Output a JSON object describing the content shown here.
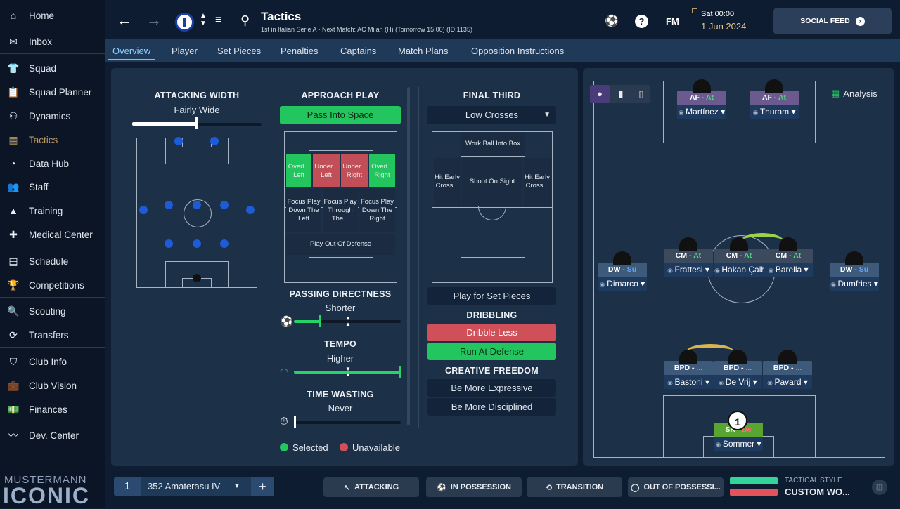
{
  "sidebar": {
    "items": [
      {
        "label": "Home",
        "icon": "home-icon"
      },
      {
        "label": "Inbox",
        "icon": "inbox-icon"
      },
      {
        "label": "Squad",
        "icon": "shirt-icon"
      },
      {
        "label": "Squad Planner",
        "icon": "clipboard-icon"
      },
      {
        "label": "Dynamics",
        "icon": "dynamics-icon"
      },
      {
        "label": "Tactics",
        "icon": "tactics-board-icon"
      },
      {
        "label": "Data Hub",
        "icon": "data-hub-icon"
      },
      {
        "label": "Staff",
        "icon": "staff-icon"
      },
      {
        "label": "Training",
        "icon": "training-cone-icon"
      },
      {
        "label": "Medical Center",
        "icon": "medical-kit-icon"
      },
      {
        "label": "Schedule",
        "icon": "calendar-icon"
      },
      {
        "label": "Competitions",
        "icon": "trophy-icon"
      },
      {
        "label": "Scouting",
        "icon": "magnifier-icon"
      },
      {
        "label": "Transfers",
        "icon": "transfer-arrows-icon"
      },
      {
        "label": "Club Info",
        "icon": "shield-icon"
      },
      {
        "label": "Club Vision",
        "icon": "briefcase-icon"
      },
      {
        "label": "Finances",
        "icon": "money-icon"
      },
      {
        "label": "Dev. Center",
        "icon": "dev-center-icon"
      }
    ],
    "brand_top": "MUSTERMANN",
    "brand_bottom": "ICONIC"
  },
  "topbar": {
    "title": "Tactics",
    "subtitle": "1st in Italian Serie A - Next Match: AC Milan (H) (Tomorrow 15:00) (ID:1135)",
    "date_line1": "Sat 00:00",
    "date_line2": "1 Jun 2024",
    "fm_label": "FM",
    "social_feed": "SOCIAL FEED"
  },
  "tabs": [
    "Overview",
    "Player",
    "Set Pieces",
    "Penalties",
    "Captains",
    "Match Plans",
    "Opposition Instructions"
  ],
  "attacking_width": {
    "title": "ATTACKING WIDTH",
    "value": "Fairly Wide",
    "level": 0.5
  },
  "approach_play": {
    "title": "APPROACH PLAY",
    "selected": "Pass Into Space",
    "zones": {
      "overlap_left": "Overl... Left",
      "underlap_left": "Under... Left",
      "underlap_right": "Under... Right",
      "overlap_right": "Overl... Right",
      "focus_left": "Focus Play Down The Left",
      "focus_centre": "Focus Play Through The...",
      "focus_right": "Focus Play Down The Right",
      "play_out": "Play Out Of Defense"
    }
  },
  "passing_directness": {
    "title": "PASSING DIRECTNESS",
    "value": "Shorter",
    "level": 0.25
  },
  "tempo": {
    "title": "TEMPO",
    "value": "Higher",
    "level": 1.0
  },
  "time_wasting": {
    "title": "TIME WASTING",
    "value": "Never",
    "level": 0.0
  },
  "final_third": {
    "title": "FINAL THIRD",
    "dropdown": "Low Crosses",
    "zones": {
      "work_ball": "Work Ball Into Box",
      "hit_left": "Hit Early Cross...",
      "shoot": "Shoot On Sight",
      "hit_right": "Hit Early Cross..."
    },
    "set_pieces": "Play for Set Pieces"
  },
  "dribbling": {
    "title": "DRIBBLING",
    "less": "Dribble Less",
    "run": "Run At Defense"
  },
  "creative_freedom": {
    "title": "CREATIVE FREEDOM",
    "expressive": "Be More Expressive",
    "disciplined": "Be More Disciplined"
  },
  "legend": {
    "selected": "Selected",
    "unavailable": "Unavailable"
  },
  "analysis": "Analysis",
  "players": [
    {
      "role": "AF",
      "duty": "At",
      "name": "Martínez"
    },
    {
      "role": "AF",
      "duty": "At",
      "name": "Thuram"
    },
    {
      "role": "DW",
      "duty": "Su",
      "name": "Dimarco"
    },
    {
      "role": "CM",
      "duty": "At",
      "name": "Frattesi"
    },
    {
      "role": "CM",
      "duty": "At",
      "name": "Hakan Çalh..."
    },
    {
      "role": "CM",
      "duty": "At",
      "name": "Barella"
    },
    {
      "role": "DW",
      "duty": "Su",
      "name": "Dumfries"
    },
    {
      "role": "BPD",
      "duty": "...",
      "name": "Bastoni"
    },
    {
      "role": "BPD",
      "duty": "...",
      "name": "De Vrij"
    },
    {
      "role": "BPD",
      "duty": "...",
      "name": "Pavard"
    },
    {
      "role": "SK",
      "duty": "De",
      "name": "Sommer"
    }
  ],
  "gk_number": "1",
  "bottombar": {
    "slot": "1",
    "tactic_name": "352 Amaterasu IV",
    "plus": "+",
    "attacking": "ATTACKING",
    "in_possession": "IN POSSESSION",
    "transition": "TRANSITION",
    "out_of_possession": "OUT OF POSSESSI...",
    "tactical_style_label": "TACTICAL STYLE",
    "tactical_style_value": "CUSTOM WO..."
  },
  "colors": {
    "accent": "#22c55e",
    "unavailable": "#d0505a",
    "active_nav": "#b89a66",
    "tab_active": "#8fd0ff"
  }
}
